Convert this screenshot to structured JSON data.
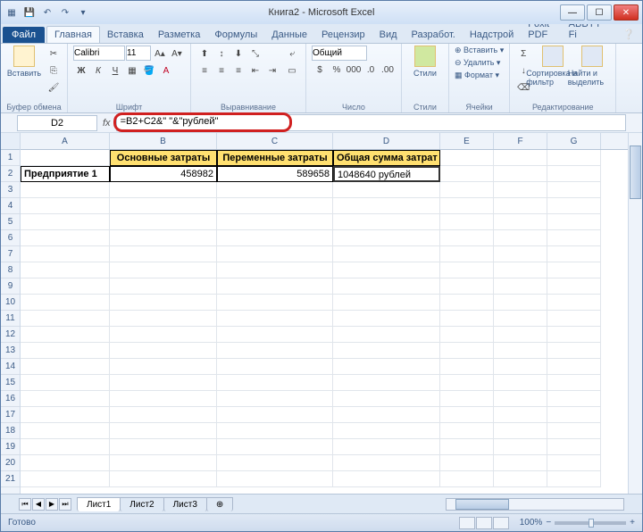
{
  "title": "Книга2 - Microsoft Excel",
  "qat": {
    "save": "💾",
    "undo": "↶",
    "redo": "↷"
  },
  "winbtns": {
    "min": "—",
    "max": "☐",
    "close": "✕"
  },
  "tabs": {
    "file": "Файл",
    "items": [
      "Главная",
      "Вставка",
      "Разметка",
      "Формулы",
      "Данные",
      "Рецензир",
      "Вид",
      "Разработ.",
      "Надстрой",
      "Foxit PDF",
      "ABBYY Fi"
    ],
    "active_index": 0
  },
  "ribbon": {
    "clipboard": {
      "paste": "Вставить",
      "label": "Буфер обмена"
    },
    "font": {
      "name": "Calibri",
      "size": "11",
      "label": "Шрифт"
    },
    "align": {
      "label": "Выравнивание"
    },
    "number": {
      "format": "Общий",
      "label": "Число"
    },
    "styles": {
      "btn": "Стили",
      "label": "Стили"
    },
    "cells": {
      "insert": "Вставить",
      "delete": "Удалить",
      "format": "Формат",
      "label": "Ячейки"
    },
    "editing": {
      "sort": "Сортировка и фильтр",
      "find": "Найти и выделить",
      "label": "Редактирование"
    }
  },
  "namebox": "D2",
  "fx_label": "fx",
  "formula": "=B2+C2&\" \"&\"рублей\"",
  "columns": [
    "A",
    "B",
    "C",
    "D",
    "E",
    "F",
    "G"
  ],
  "row_count": 21,
  "headers": {
    "b1": "Основные затраты",
    "c1": "Переменные затраты",
    "d1": "Общая сумма затрат"
  },
  "data": {
    "a2": "Предприятие 1",
    "b2": "458982",
    "c2": "589658",
    "d2": "1048640 рублей"
  },
  "sheets": {
    "items": [
      "Лист1",
      "Лист2",
      "Лист3"
    ],
    "nav": [
      "⏮",
      "◀",
      "▶",
      "⏭"
    ]
  },
  "status": {
    "ready": "Готово",
    "zoom": "100%",
    "minus": "−",
    "plus": "+"
  }
}
